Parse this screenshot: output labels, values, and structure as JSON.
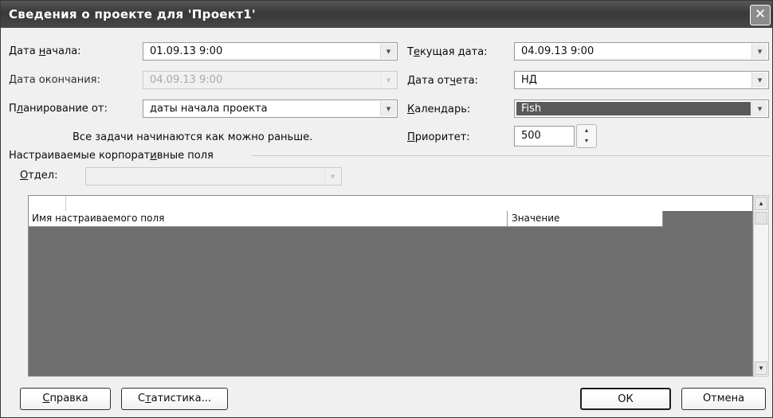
{
  "window": {
    "title": "Сведения о проекте для 'Проект1'",
    "close_glyph": "✕"
  },
  "fields": {
    "start_date": {
      "label_pre": "Дата ",
      "label_ul": "н",
      "label_post": "ачала:",
      "value": "01.09.13 9:00"
    },
    "finish_date": {
      "label": "Дата окончания:",
      "value": "04.09.13 9:00"
    },
    "schedule_from": {
      "label_pre": "П",
      "label_ul": "л",
      "label_post": "анирование от:",
      "value": "даты начала проекта"
    },
    "schedule_note": "Все задачи начинаются как можно раньше.",
    "current_date": {
      "label_pre": "Т",
      "label_ul": "е",
      "label_post": "кущая дата:",
      "value": "04.09.13 9:00"
    },
    "status_date": {
      "label_pre": "Дата от",
      "label_ul": "ч",
      "label_post": "ета:",
      "value": "НД"
    },
    "calendar": {
      "label_pre": "",
      "label_ul": "К",
      "label_post": "алендарь:",
      "value": "Fish"
    },
    "priority": {
      "label_pre": "",
      "label_ul": "П",
      "label_post": "риоритет:",
      "value": "500"
    }
  },
  "enterprise": {
    "group_pre": "Настраиваемые корпорат",
    "group_ul": "и",
    "group_post": "вные поля",
    "department_pre": "",
    "department_ul": "О",
    "department_post": "тдел:",
    "department_value": ""
  },
  "grid": {
    "col_name": "Имя настраиваемого поля",
    "col_value": "Значение"
  },
  "buttons": {
    "help_ul": "С",
    "help_rest": "правка",
    "stats_pre": "С",
    "stats_ul": "т",
    "stats_post": "атистика...",
    "ok": "ОК",
    "cancel": "Отмена"
  },
  "glyphs": {
    "dropdown": "▾",
    "up": "▴",
    "down": "▾"
  }
}
